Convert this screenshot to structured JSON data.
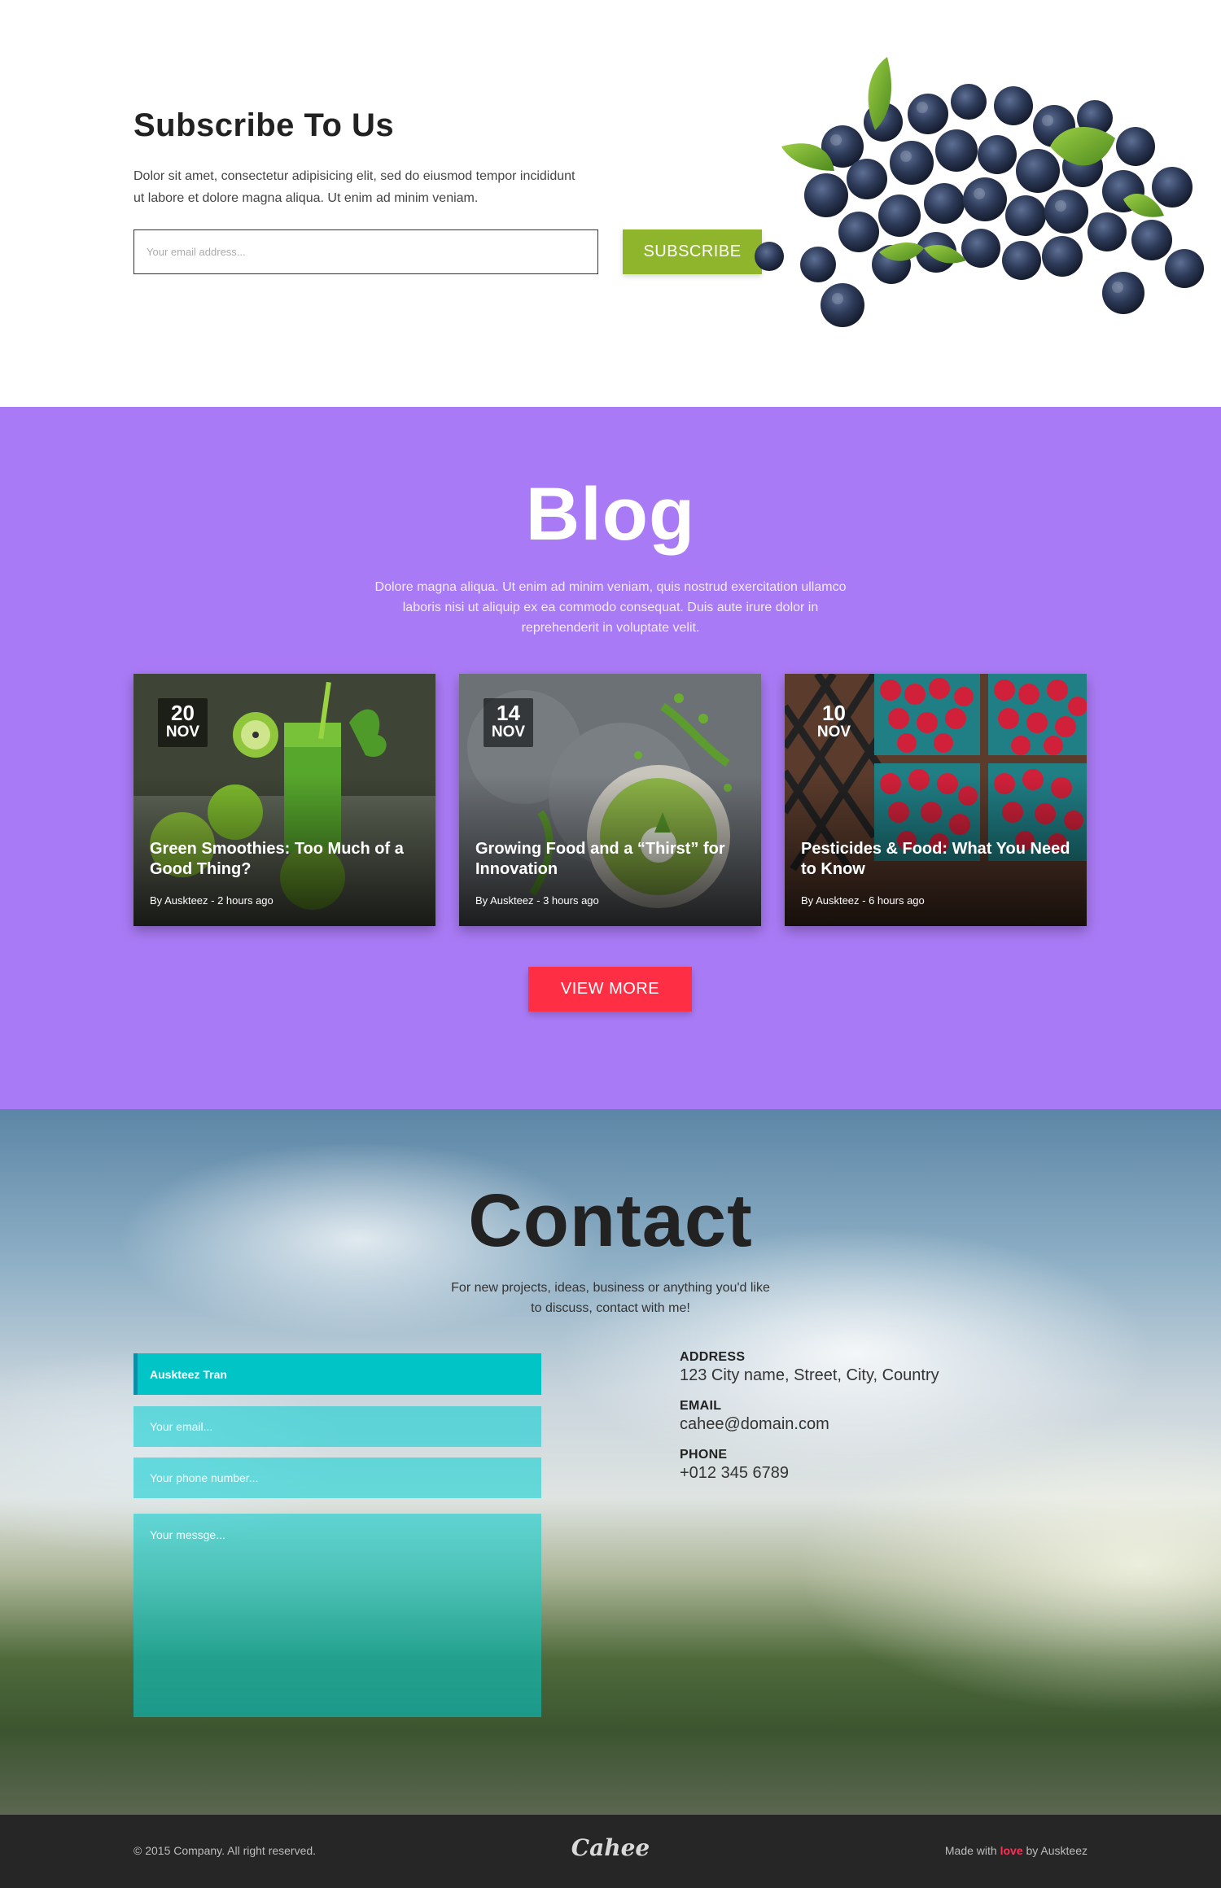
{
  "subscribe": {
    "title": "Subscribe To Us",
    "description": "Dolor sit amet, consectetur adipisicing elit, sed do eiusmod tempor incididunt ut labore et dolore magna aliqua. Ut enim ad minim veniam.",
    "email_placeholder": "Your email address...",
    "button_label": "SUBSCRIBE"
  },
  "blog": {
    "title": "Blog",
    "description": "Dolore magna aliqua. Ut enim ad minim veniam, quis nostrud exercitation ullamco laboris nisi ut aliquip ex ea commodo consequat. Duis aute irure dolor in reprehenderit in voluptate velit.",
    "posts": [
      {
        "day": "20",
        "month": "NOV",
        "title": "Green Smoothies: Too Much of a Good Thing?",
        "meta": "By Auskteez - 2 hours ago"
      },
      {
        "day": "14",
        "month": "NOV",
        "title": "Growing Food and a “Thirst” for Innovation",
        "meta": "By Auskteez - 3 hours ago"
      },
      {
        "day": "10",
        "month": "NOV",
        "title": "Pesticides & Food: What You Need to Know",
        "meta": "By Auskteez - 6 hours ago"
      }
    ],
    "view_more_label": "VIEW MORE"
  },
  "contact": {
    "title": "Contact",
    "description": "For new projects, ideas, business or anything you'd like to discuss, contact with me!",
    "name_value": "Auskteez Tran",
    "email_placeholder": "Your email...",
    "phone_placeholder": "Your phone number...",
    "message_placeholder": "Your messge...",
    "address_label": "ADDRESS",
    "address": "123 City name, Street, City, Country",
    "email_label": "EMAIL",
    "email": "cahee@domain.com",
    "phone_label": "PHONE",
    "phone": "+012 345 6789"
  },
  "footer": {
    "copyright": "© 2015 Company. All right reserved.",
    "logo": "Cahee",
    "made_prefix": "Made with",
    "made_love": "love",
    "made_suffix": "by Auskteez"
  },
  "colors": {
    "subscribe_button": "#8fb52c",
    "blog_background": "#a97af5",
    "view_more_button": "#fe2f44",
    "contact_field": "#00c4c6",
    "footer_background": "#262626",
    "love_accent": "#ff2f55"
  }
}
